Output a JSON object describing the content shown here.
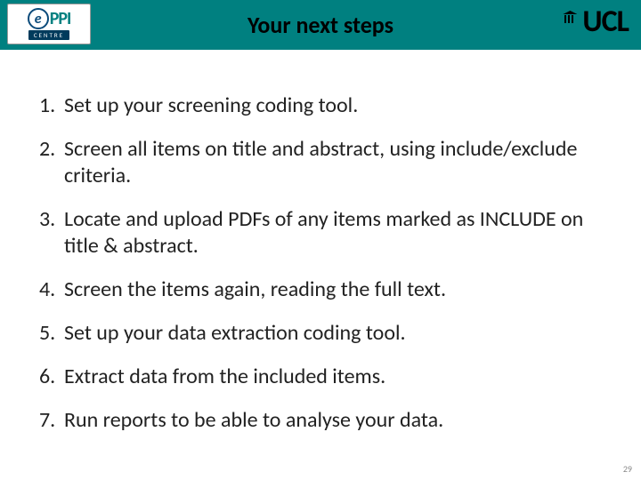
{
  "header": {
    "title": "Your next steps",
    "logo_left": {
      "e": "e",
      "ppi": "PPI",
      "centre": "CENTRE"
    },
    "logo_right": {
      "text": "UCL"
    }
  },
  "steps": [
    "Set up your screening coding tool.",
    "Screen all items on title and abstract, using include/exclude criteria.",
    "Locate and upload PDFs of any items marked as INCLUDE on title & abstract.",
    "Screen the items again, reading the full text.",
    "Set up your data extraction coding tool.",
    "Extract data from the included items.",
    "Run reports to be able to analyse your data."
  ],
  "page_number": "29"
}
